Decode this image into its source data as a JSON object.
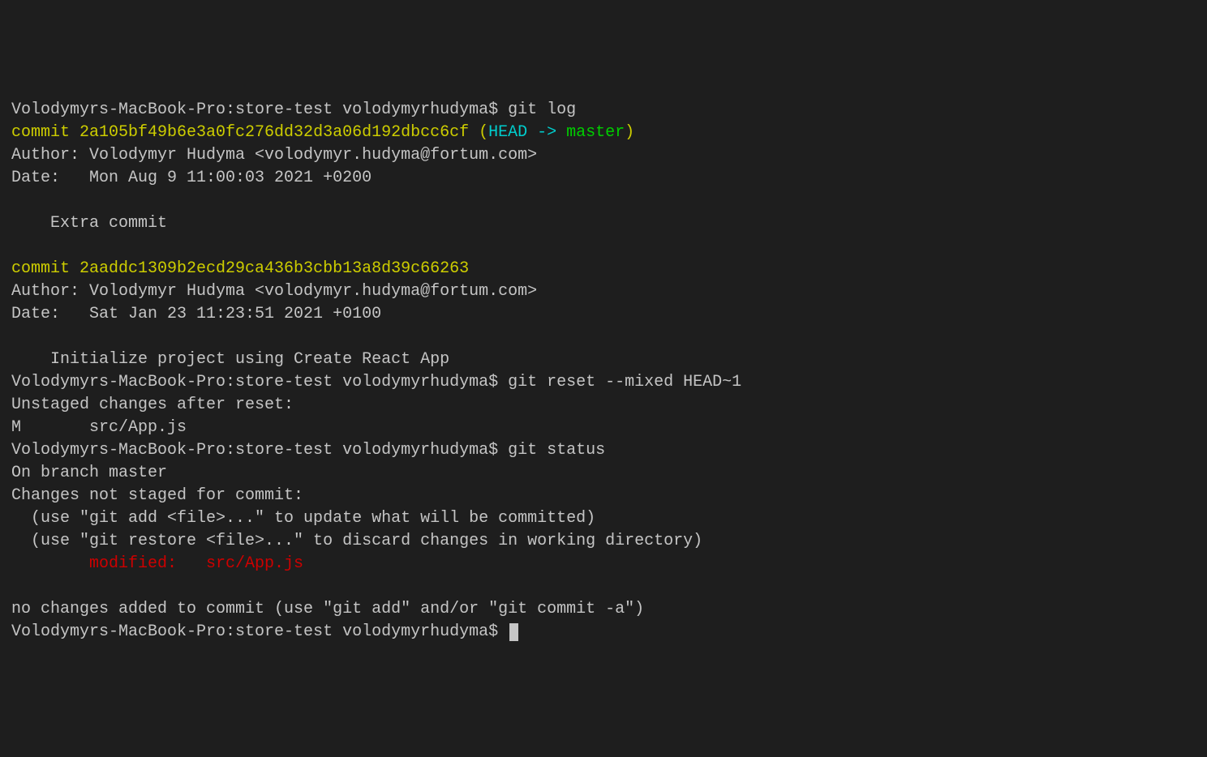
{
  "prompt": "Volodymyrs-MacBook-Pro:store-test volodymyrhudyma$ ",
  "commands": {
    "gitLog": "git log",
    "gitReset": "git reset --mixed HEAD~1",
    "gitStatus": "git status"
  },
  "commit1": {
    "label": "commit ",
    "hash": "2a105bf49b6e3a0fc276dd32d3a06d192dbcc6cf",
    "refOpen": " (",
    "head": "HEAD -> ",
    "branch": "master",
    "refClose": ")",
    "author": "Author: Volodymyr Hudyma <volodymyr.hudyma@fortum.com>",
    "date": "Date:   Mon Aug 9 11:00:03 2021 +0200",
    "message": "    Extra commit"
  },
  "commit2": {
    "label": "commit ",
    "hash": "2aaddc1309b2ecd29ca436b3cbb13a8d39c66263",
    "author": "Author: Volodymyr Hudyma <volodymyr.hudyma@fortum.com>",
    "date": "Date:   Sat Jan 23 11:23:51 2021 +0100",
    "message": "    Initialize project using Create React App"
  },
  "reset": {
    "unstaged": "Unstaged changes after reset:",
    "file": "M       src/App.js"
  },
  "status": {
    "branch": "On branch master",
    "notStaged": "Changes not staged for commit:",
    "hint1": "  (use \"git add <file>...\" to update what will be committed)",
    "hint2": "  (use \"git restore <file>...\" to discard changes in working directory)",
    "modifiedIndent": "        ",
    "modified": "modified:   src/App.js",
    "noChanges": "no changes added to commit (use \"git add\" and/or \"git commit -a\")"
  }
}
